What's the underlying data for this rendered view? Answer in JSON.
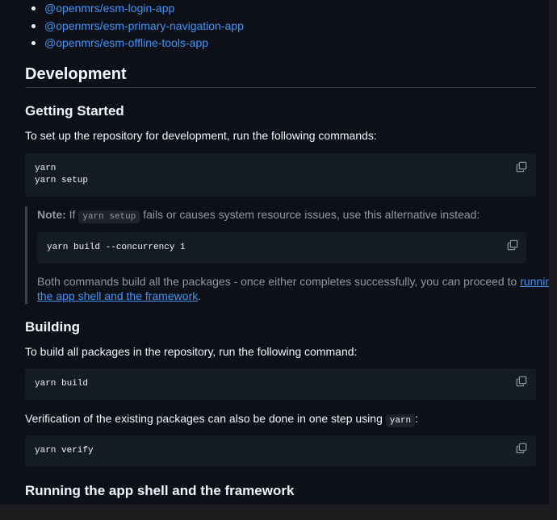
{
  "packages": [
    {
      "label": "@openmrs/esm-login-app"
    },
    {
      "label": "@openmrs/esm-primary-navigation-app"
    },
    {
      "label": "@openmrs/esm-offline-tools-app"
    }
  ],
  "development": {
    "heading": "Development",
    "getting_started": {
      "heading": "Getting Started",
      "intro": "To set up the repository for development, run the following commands:",
      "code": "yarn\nyarn setup",
      "note": {
        "label": "Note:",
        "pre": "If",
        "code_inline": "yarn setup",
        "post": "fails or causes system resource issues, use this alternative instead:",
        "code": "yarn build --concurrency 1",
        "follow_text": "Both commands build all the packages - once either completes successfully, you can proceed to",
        "link_part1": "running",
        "link_part2": "the app shell and the framework",
        "end": "."
      }
    },
    "building": {
      "heading": "Building",
      "intro": "To build all packages in the repository, run the following command:",
      "code": "yarn build",
      "verify_text": "Verification of the existing packages can also be done in one step using",
      "verify_inline": "yarn",
      "verify_end": ":",
      "verify_code": "yarn verify"
    },
    "running": {
      "heading": "Running the app shell and the framework"
    }
  },
  "icons": {
    "copy": "copy-icon"
  },
  "colors": {
    "background": "#0d1117",
    "link": "#4493f8",
    "code_bg": "#151b23",
    "muted": "#9198a1"
  }
}
